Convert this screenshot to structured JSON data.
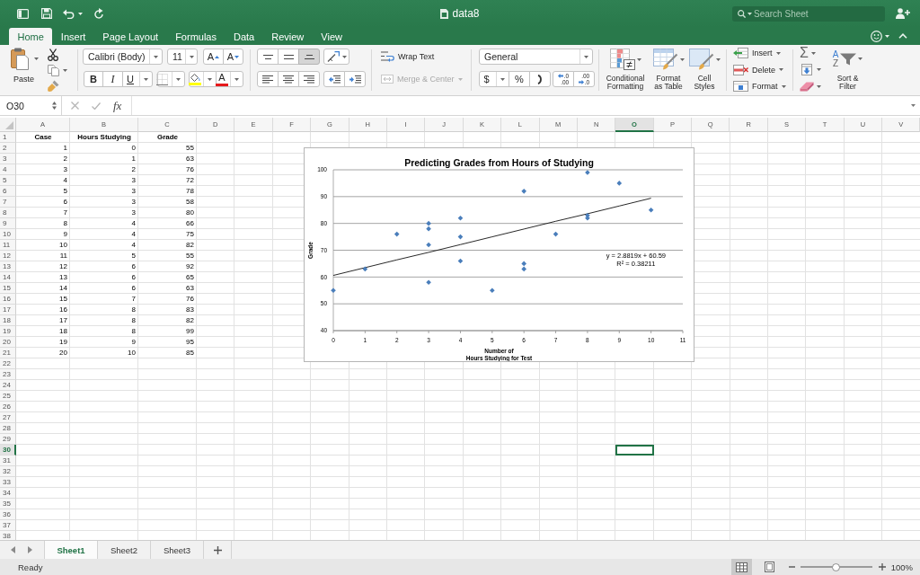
{
  "window": {
    "title": "data8"
  },
  "search": {
    "placeholder": "Search Sheet"
  },
  "ribbon_tabs": [
    {
      "label": "Home",
      "selected": true
    },
    {
      "label": "Insert",
      "selected": false
    },
    {
      "label": "Page Layout",
      "selected": false
    },
    {
      "label": "Formulas",
      "selected": false
    },
    {
      "label": "Data",
      "selected": false
    },
    {
      "label": "Review",
      "selected": false
    },
    {
      "label": "View",
      "selected": false
    }
  ],
  "ribbon": {
    "clipboard": {
      "paste": "Paste"
    },
    "font": {
      "name": "Calibri (Body)",
      "size": "11",
      "grow": "A",
      "shrink": "A",
      "bold": "B",
      "italic": "I",
      "underline": "U",
      "font_color": "A"
    },
    "alignment": {
      "vertical": [
        {
          "selected": false
        },
        {
          "selected": false
        },
        {
          "selected": true
        }
      ],
      "horizontal": [
        {
          "selected": false
        },
        {
          "selected": false
        },
        {
          "selected": false
        }
      ]
    },
    "wrap_text": {
      "label": "Wrap Text",
      "disabled": false
    },
    "merge": {
      "label": "Merge & Center",
      "disabled": true
    },
    "number": {
      "format": "General",
      "currency": "$",
      "percent": "%",
      "decimals": [
        {
          "kind": "increase",
          "lines": [
            ".0",
            ".00"
          ]
        },
        {
          "kind": "decrease",
          "lines": [
            ".00",
            ".0"
          ]
        }
      ]
    },
    "styles": [
      {
        "kind": "conditional",
        "label": "Conditional\nFormatting"
      },
      {
        "kind": "table",
        "label": "Format\nas Table"
      },
      {
        "kind": "cell",
        "label": "Cell\nStyles"
      }
    ],
    "cells": [
      {
        "kind": "insert",
        "label": "Insert"
      },
      {
        "kind": "delete",
        "label": "Delete"
      },
      {
        "kind": "format",
        "label": "Format"
      }
    ],
    "editing": {
      "autosum": "Σ",
      "sort_letters": [
        "A",
        "Z"
      ],
      "sort_label": "Sort &\nFilter"
    }
  },
  "formula_bar": {
    "name_box": "O30",
    "function_label": "fx"
  },
  "sheet": {
    "columns": [
      {
        "label": "A",
        "selected": false
      },
      {
        "label": "B",
        "selected": false
      },
      {
        "label": "C",
        "selected": false
      },
      {
        "label": "D",
        "selected": false
      },
      {
        "label": "E",
        "selected": false
      },
      {
        "label": "F",
        "selected": false
      },
      {
        "label": "G",
        "selected": false
      },
      {
        "label": "H",
        "selected": false
      },
      {
        "label": "I",
        "selected": false
      },
      {
        "label": "J",
        "selected": false
      },
      {
        "label": "K",
        "selected": false
      },
      {
        "label": "L",
        "selected": false
      },
      {
        "label": "M",
        "selected": false
      },
      {
        "label": "N",
        "selected": false
      },
      {
        "label": "O",
        "selected": true
      },
      {
        "label": "P",
        "selected": false
      },
      {
        "label": "Q",
        "selected": false
      },
      {
        "label": "R",
        "selected": false
      },
      {
        "label": "S",
        "selected": false
      },
      {
        "label": "T",
        "selected": false
      },
      {
        "label": "U",
        "selected": false
      },
      {
        "label": "V",
        "selected": false
      }
    ],
    "rows": [
      {
        "label": "1",
        "selected": false,
        "kind": "header",
        "cells": [
          "Case",
          "Hours Studying",
          "Grade"
        ]
      },
      {
        "label": "2",
        "selected": false,
        "kind": "data",
        "cells": [
          "1",
          "0",
          "55"
        ]
      },
      {
        "label": "3",
        "selected": false,
        "kind": "data",
        "cells": [
          "2",
          "1",
          "63"
        ]
      },
      {
        "label": "4",
        "selected": false,
        "kind": "data",
        "cells": [
          "3",
          "2",
          "76"
        ]
      },
      {
        "label": "5",
        "selected": false,
        "kind": "data",
        "cells": [
          "4",
          "3",
          "72"
        ]
      },
      {
        "label": "6",
        "selected": false,
        "kind": "data",
        "cells": [
          "5",
          "3",
          "78"
        ]
      },
      {
        "label": "7",
        "selected": false,
        "kind": "data",
        "cells": [
          "6",
          "3",
          "58"
        ]
      },
      {
        "label": "8",
        "selected": false,
        "kind": "data",
        "cells": [
          "7",
          "3",
          "80"
        ]
      },
      {
        "label": "9",
        "selected": false,
        "kind": "data",
        "cells": [
          "8",
          "4",
          "66"
        ]
      },
      {
        "label": "10",
        "selected": false,
        "kind": "data",
        "cells": [
          "9",
          "4",
          "75"
        ]
      },
      {
        "label": "11",
        "selected": false,
        "kind": "data",
        "cells": [
          "10",
          "4",
          "82"
        ]
      },
      {
        "label": "12",
        "selected": false,
        "kind": "data",
        "cells": [
          "11",
          "5",
          "55"
        ]
      },
      {
        "label": "13",
        "selected": false,
        "kind": "data",
        "cells": [
          "12",
          "6",
          "92"
        ]
      },
      {
        "label": "14",
        "selected": false,
        "kind": "data",
        "cells": [
          "13",
          "6",
          "65"
        ]
      },
      {
        "label": "15",
        "selected": false,
        "kind": "data",
        "cells": [
          "14",
          "6",
          "63"
        ]
      },
      {
        "label": "16",
        "selected": false,
        "kind": "data",
        "cells": [
          "15",
          "7",
          "76"
        ]
      },
      {
        "label": "17",
        "selected": false,
        "kind": "data",
        "cells": [
          "16",
          "8",
          "83"
        ]
      },
      {
        "label": "18",
        "selected": false,
        "kind": "data",
        "cells": [
          "17",
          "8",
          "82"
        ]
      },
      {
        "label": "19",
        "selected": false,
        "kind": "data",
        "cells": [
          "18",
          "8",
          "99"
        ]
      },
      {
        "label": "20",
        "selected": false,
        "kind": "data",
        "cells": [
          "19",
          "9",
          "95"
        ]
      },
      {
        "label": "21",
        "selected": false,
        "kind": "data",
        "cells": [
          "20",
          "10",
          "85"
        ]
      },
      {
        "label": "22",
        "selected": false
      },
      {
        "label": "23",
        "selected": false
      },
      {
        "label": "24",
        "selected": false
      },
      {
        "label": "25",
        "selected": false
      },
      {
        "label": "26",
        "selected": false
      },
      {
        "label": "27",
        "selected": false
      },
      {
        "label": "28",
        "selected": false
      },
      {
        "label": "29",
        "selected": false
      },
      {
        "label": "30",
        "selected": true
      },
      {
        "label": "31",
        "selected": false
      },
      {
        "label": "32",
        "selected": false
      },
      {
        "label": "33",
        "selected": false
      },
      {
        "label": "34",
        "selected": false
      },
      {
        "label": "35",
        "selected": false
      },
      {
        "label": "36",
        "selected": false
      },
      {
        "label": "37",
        "selected": false
      },
      {
        "label": "38",
        "selected": false
      }
    ],
    "chart": {
      "chart_data": {
        "type": "scatter",
        "title": "Predicting Grades from Hours of Studying",
        "xlabel": "Number of\nHours Studying for Test",
        "ylabel": "Grade",
        "x": [
          0,
          1,
          2,
          3,
          3,
          3,
          3,
          4,
          4,
          4,
          5,
          6,
          6,
          6,
          7,
          8,
          8,
          8,
          9,
          10
        ],
        "series": [
          {
            "color": "#4a7ebb",
            "values": [
              55,
              63,
              76,
              72,
              78,
              58,
              80,
              66,
              75,
              82,
              55,
              92,
              65,
              63,
              76,
              83,
              82,
              99,
              95,
              85
            ]
          },
          {
            "name": "y = 2.8819x + 60.59",
            "type": "line",
            "color": "#111111",
            "values": [
              60.6,
              63.5,
              66.4,
              69.2,
              69.2,
              69.2,
              69.2,
              72.1,
              72.1,
              72.1,
              75.0,
              77.9,
              77.9,
              77.9,
              80.8,
              83.6,
              83.6,
              83.6,
              86.5,
              89.4
            ]
          }
        ],
        "xlim": [
          0,
          11
        ],
        "ylim": [
          40,
          100
        ],
        "xticks": [
          0,
          1,
          2,
          3,
          4,
          5,
          6,
          7,
          8,
          9,
          10,
          11
        ],
        "yticks": [
          40,
          50,
          60,
          70,
          80,
          90,
          100
        ],
        "grid": true,
        "annotations": [
          "R² = 0.38211"
        ]
      }
    }
  },
  "sheet_tabs": [
    {
      "label": "Sheet1",
      "selected": true
    },
    {
      "label": "Sheet2",
      "selected": false
    },
    {
      "label": "Sheet3",
      "selected": false
    }
  ],
  "status_bar": {
    "text": "Ready",
    "views": [
      {
        "kind": "normal",
        "selected": true
      },
      {
        "kind": "page_layout",
        "selected": false
      }
    ],
    "zoom": {
      "level": 0.5,
      "reading": "100%"
    }
  }
}
